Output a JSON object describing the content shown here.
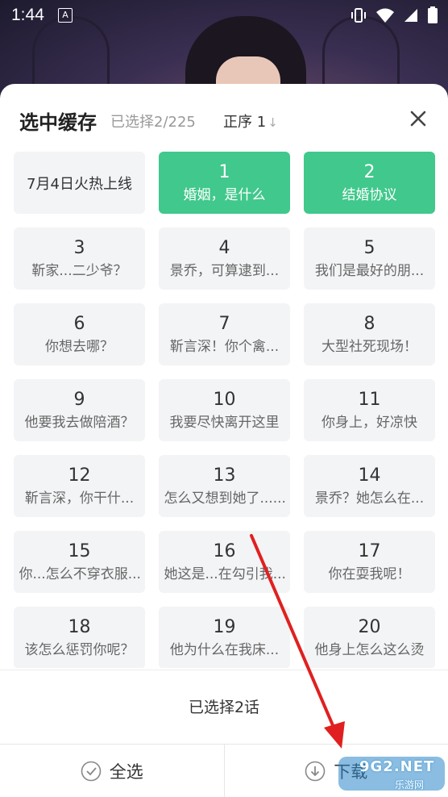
{
  "status_bar": {
    "time": "1:44",
    "sim_glyph": "A"
  },
  "sheet": {
    "title": "选中缓存",
    "selected_count": "已选择2/225",
    "sort_label": "正序 1",
    "sort_icon": "↓"
  },
  "info_tile": "7月4日火热上线",
  "episodes": [
    {
      "num": "1",
      "name": "婚姻，是什么",
      "selected": true
    },
    {
      "num": "2",
      "name": "结婚协议",
      "selected": true
    },
    {
      "num": "3",
      "name": "靳家...二少爷？",
      "selected": false
    },
    {
      "num": "4",
      "name": "景乔，可算逮到...",
      "selected": false
    },
    {
      "num": "5",
      "name": "我们是最好的朋...",
      "selected": false
    },
    {
      "num": "6",
      "name": "你想去哪？",
      "selected": false
    },
    {
      "num": "7",
      "name": "靳言深！你个禽...",
      "selected": false
    },
    {
      "num": "8",
      "name": "大型社死现场！",
      "selected": false
    },
    {
      "num": "9",
      "name": "他要我去做陪酒？",
      "selected": false
    },
    {
      "num": "10",
      "name": "我要尽快离开这里",
      "selected": false
    },
    {
      "num": "11",
      "name": "你身上，好凉快",
      "selected": false
    },
    {
      "num": "12",
      "name": "靳言深，你干什...",
      "selected": false
    },
    {
      "num": "13",
      "name": "怎么又想到她了......",
      "selected": false
    },
    {
      "num": "14",
      "name": "景乔？她怎么在...",
      "selected": false
    },
    {
      "num": "15",
      "name": "你...怎么不穿衣服...",
      "selected": false
    },
    {
      "num": "16",
      "name": "她这是...在勾引我...",
      "selected": false
    },
    {
      "num": "17",
      "name": "你在耍我呢！",
      "selected": false
    },
    {
      "num": "18",
      "name": "该怎么惩罚你呢？",
      "selected": false
    },
    {
      "num": "19",
      "name": "他为什么在我床...",
      "selected": false
    },
    {
      "num": "20",
      "name": "他身上怎么这么烫",
      "selected": false
    }
  ],
  "summary": "已选择2话",
  "bottom": {
    "select_all": "全选",
    "download": "下载"
  },
  "watermark": {
    "text": "9G2.NET",
    "sub": "乐游网"
  },
  "colors": {
    "accent": "#41c88c",
    "tile_bg": "#f3f4f6",
    "arrow": "#e02020"
  }
}
